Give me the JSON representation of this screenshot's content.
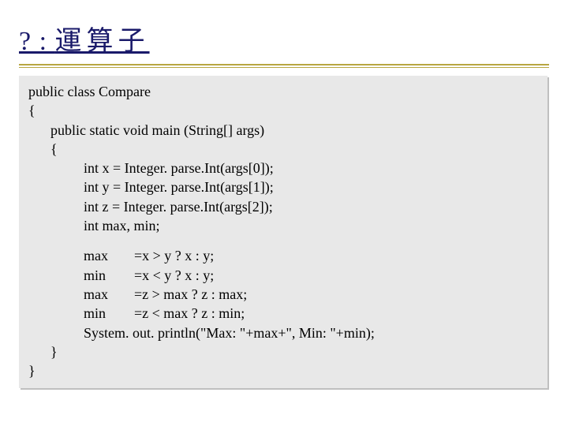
{
  "title_prefix": "? : ",
  "title_cjk": "運算子",
  "code": {
    "l00": "public class Compare",
    "l01": "{",
    "l02": "public static void main (String[] args)",
    "l03": "{",
    "l04": "int x = Integer. parse.Int(args[0]);",
    "l05": "int y = Integer. parse.Int(args[1]);",
    "l06": "int z = Integer. parse.Int(args[2]);",
    "l07": "int max, min;",
    "a1l": "max",
    "a1r": "=x > y ? x : y;",
    "a2l": "min",
    "a2r": "=x < y ? x : y;",
    "a3l": "max",
    "a3r": "=z > max ? z : max;",
    "a4l": "min",
    "a4r": "=z < max ? z : min;",
    "l12": "System. out. println(\"Max: \"+max+\", Min: \"+min);",
    "l13": "}",
    "l14": "}"
  }
}
